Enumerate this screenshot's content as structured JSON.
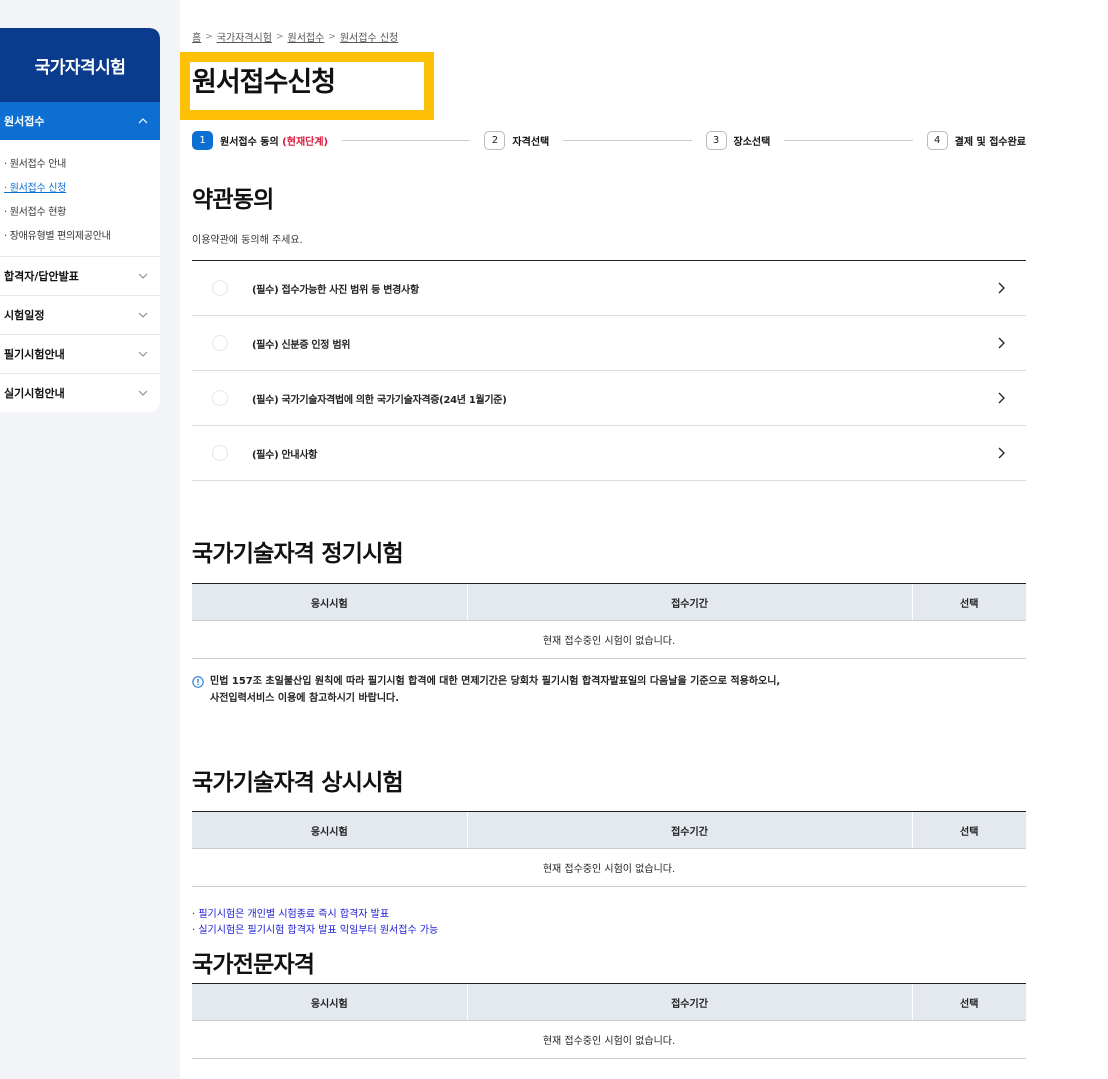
{
  "sidebar": {
    "title": "국가자격시험",
    "active_menu": "원서접수",
    "submenu": [
      "· 원서접수 안내",
      "· 원서접수 신청",
      "· 원서접수 현황",
      "· 장애유형별 편의제공안내"
    ],
    "menus": [
      "합격자/답안발표",
      "시험일정",
      "필기시험안내",
      "실기시험안내"
    ]
  },
  "breadcrumb": [
    "홈",
    "국가자격시험",
    "원서접수",
    "원서접수 신청"
  ],
  "page_title": "원서접수신청",
  "steps": [
    {
      "num": "1",
      "label": "원서접수 동의",
      "current": "(현재단계)"
    },
    {
      "num": "2",
      "label": "자격선택"
    },
    {
      "num": "3",
      "label": "장소선택"
    },
    {
      "num": "4",
      "label": "결제 및 접수완료"
    }
  ],
  "terms": {
    "heading": "약관동의",
    "description": "이용약관에 동의해 주세요.",
    "items": [
      "(필수) 접수가능한 사진 범위 등 변경사항",
      "(필수) 신분증 인정 범위",
      "(필수) 국가기술자격법에 의한 국가기술자격증(24년 1월기준)",
      "(필수) 안내사항"
    ]
  },
  "table_headers": [
    "응시시험",
    "접수기간",
    "선택"
  ],
  "regular": {
    "heading": "국가기술자격 정기시험",
    "empty": "현재 접수중인 시험이 없습니다.",
    "notice_line1": "민법 157조 초일불산입 원칙에 따라 필기시험 합격에 대한 면제기간은 당회차 필기시험 합격자발표일의 다음날을 기준으로 적용하오니,",
    "notice_line2": "사전입력서비스 이용에 참고하시기 바랍니다."
  },
  "ondemand": {
    "heading": "국가기술자격 상시시험",
    "empty": "현재 접수중인 시험이 없습니다.",
    "note1": "· 필기시험은 개인별 시험종료 즉시 합격자 발표",
    "note2": "· 실기시험은 필기시험 합격자 발표 익일부터 원서접수 가능"
  },
  "professional": {
    "heading": "국가전문자격",
    "empty": "현재 접수중인 시험이 없습니다."
  },
  "colors": {
    "sidebar_header": "#0a3b8c",
    "active_blue": "#0d6fd1",
    "highlight": "#ffc107",
    "current_step": "#d81b3d",
    "note_blue": "#1a1ad6"
  }
}
